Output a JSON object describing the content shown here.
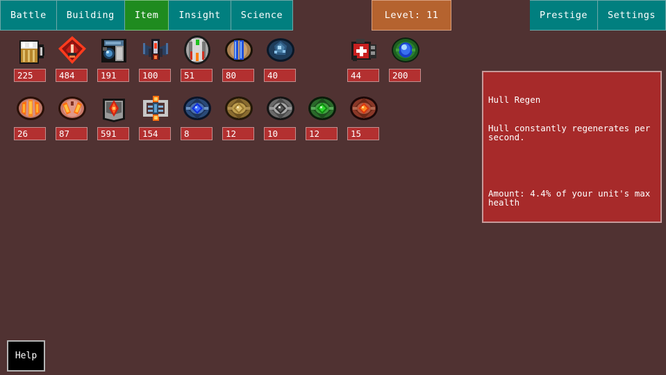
{
  "nav": {
    "tabs": [
      {
        "label": "Battle",
        "active": false,
        "name": "tab-battle"
      },
      {
        "label": "Building",
        "active": false,
        "name": "tab-building"
      },
      {
        "label": "Item",
        "active": true,
        "name": "tab-item"
      },
      {
        "label": "Insight",
        "active": false,
        "name": "tab-insight"
      },
      {
        "label": "Science",
        "active": false,
        "name": "tab-science"
      }
    ],
    "level_badge": "Level: 11",
    "right_tabs": [
      {
        "label": "Prestige",
        "name": "tab-prestige"
      },
      {
        "label": "Settings",
        "name": "tab-settings"
      }
    ]
  },
  "items": {
    "rows": [
      [
        {
          "icon": "beer-mug-icon",
          "count": "225",
          "empty": false
        },
        {
          "icon": "red-diamond-crest-icon",
          "count": "484",
          "empty": false
        },
        {
          "icon": "blue-machine-icon",
          "count": "191",
          "empty": false
        },
        {
          "icon": "winged-drone-icon",
          "count": "100",
          "empty": false
        },
        {
          "icon": "silver-capsule-icon",
          "count": "51",
          "empty": false
        },
        {
          "icon": "blue-rods-pod-icon",
          "count": "80",
          "empty": false
        },
        {
          "icon": "blue-crystal-icon",
          "count": "40",
          "empty": false
        },
        {
          "icon": "empty-slot",
          "count": "",
          "empty": true
        },
        {
          "icon": "medkit-icon",
          "count": "44",
          "empty": false
        },
        {
          "icon": "green-blue-orb-icon",
          "count": "200",
          "empty": false
        }
      ],
      [
        {
          "icon": "red-claw-orb-icon",
          "count": "26",
          "empty": false
        },
        {
          "icon": "red-talon-orb-icon",
          "count": "87",
          "empty": false
        },
        {
          "icon": "red-star-box-icon",
          "count": "591",
          "empty": false
        },
        {
          "icon": "mech-frame-icon",
          "count": "154",
          "empty": false
        },
        {
          "icon": "blue-gem-shield-icon",
          "count": "8",
          "empty": false
        },
        {
          "icon": "gold-gem-shield-icon",
          "count": "12",
          "empty": false
        },
        {
          "icon": "silver-gem-shield-icon",
          "count": "10",
          "empty": false
        },
        {
          "icon": "green-gem-shield-icon",
          "count": "12",
          "empty": false
        },
        {
          "icon": "red-gem-shield-icon",
          "count": "15",
          "empty": false
        }
      ]
    ]
  },
  "tooltip": {
    "title": "Hull Regen",
    "description": "Hull constantly regenerates per second.",
    "amount": "Amount: 4.4% of your unit's max health"
  },
  "help": {
    "label": "Help"
  },
  "colors": {
    "background": "#503232",
    "nav_teal": "#017f7f",
    "nav_active_green": "#1f8b1f",
    "level_orange": "#b5632f",
    "count_red": "#b33030",
    "tooltip_red": "#a72a2a",
    "border_light": "#c49090"
  }
}
